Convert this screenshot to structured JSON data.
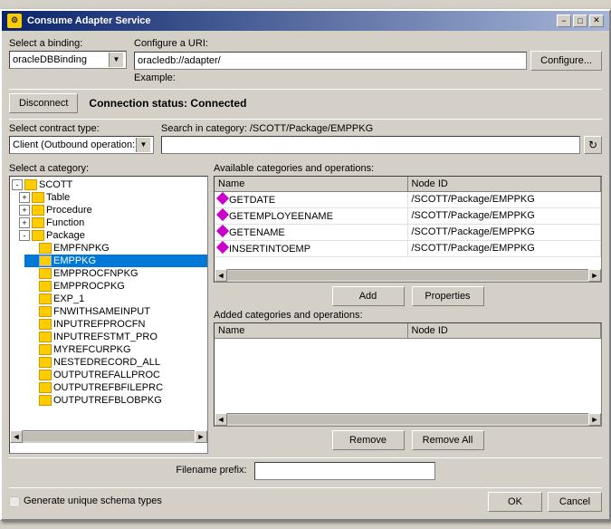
{
  "window": {
    "title": "Consume Adapter Service",
    "title_icon": "⚙"
  },
  "title_buttons": {
    "minimize": "−",
    "maximize": "□",
    "close": "✕"
  },
  "binding": {
    "label": "Select a binding:",
    "value": "oracleDBBinding"
  },
  "uri": {
    "label": "Configure a URI:",
    "value": "oracledb://adapter/",
    "example_label": "Example:",
    "configure_btn": "Configure..."
  },
  "disconnect_btn": "Disconnect",
  "connection_status": "Connection status: Connected",
  "contract": {
    "label": "Select contract type:",
    "value": "Client (Outbound operation:"
  },
  "search": {
    "label": "Search in category: /SCOTT/Package/EMPPKG",
    "placeholder": ""
  },
  "category": {
    "label": "Select a category:"
  },
  "tree_items": [
    {
      "id": "scott",
      "label": "SCOTT",
      "indent": 0,
      "expanded": true,
      "type": "node"
    },
    {
      "id": "table",
      "label": "Table",
      "indent": 1,
      "expanded": true,
      "type": "leaf"
    },
    {
      "id": "procedure",
      "label": "Procedure",
      "indent": 1,
      "expanded": true,
      "type": "leaf"
    },
    {
      "id": "function",
      "label": "Function",
      "indent": 1,
      "expanded": true,
      "type": "leaf"
    },
    {
      "id": "package",
      "label": "Package",
      "indent": 1,
      "expanded": true,
      "type": "node"
    },
    {
      "id": "empfnpkg",
      "label": "EMPFNPKG",
      "indent": 2,
      "expanded": false,
      "type": "leaf"
    },
    {
      "id": "emppkg",
      "label": "EMPPKG",
      "indent": 2,
      "expanded": false,
      "type": "leaf",
      "selected": true
    },
    {
      "id": "empprocfnpkg",
      "label": "EMPPROCFNPKG",
      "indent": 2,
      "expanded": false,
      "type": "leaf"
    },
    {
      "id": "empprocpkg",
      "label": "EMPPROCPKG",
      "indent": 2,
      "expanded": false,
      "type": "leaf"
    },
    {
      "id": "exp1",
      "label": "EXP_1",
      "indent": 2,
      "expanded": false,
      "type": "leaf"
    },
    {
      "id": "fnwithsame",
      "label": "FNWITHSAMEINPUT",
      "indent": 2,
      "expanded": false,
      "type": "leaf"
    },
    {
      "id": "inputrefprocfn",
      "label": "INPUTREFPROCFN",
      "indent": 2,
      "expanded": false,
      "type": "leaf"
    },
    {
      "id": "inputrefstmt",
      "label": "INPUTREFSTMT_PRO",
      "indent": 2,
      "expanded": false,
      "type": "leaf"
    },
    {
      "id": "myrefcurpkg",
      "label": "MYREFCURPKG",
      "indent": 2,
      "expanded": false,
      "type": "leaf"
    },
    {
      "id": "nestedrecord",
      "label": "NESTEDRECORD_ALL",
      "indent": 2,
      "expanded": false,
      "type": "leaf"
    },
    {
      "id": "outputrefallproc",
      "label": "OUTPUTREFALLPROC",
      "indent": 2,
      "expanded": false,
      "type": "leaf"
    },
    {
      "id": "outputrefbfile",
      "label": "OUTPUTREFBFILEPRC",
      "indent": 2,
      "expanded": false,
      "type": "leaf"
    },
    {
      "id": "outputrefblobpkg",
      "label": "OUTPUTREFBLOBPKG",
      "indent": 2,
      "expanded": false,
      "type": "leaf"
    }
  ],
  "available_table": {
    "label": "Available categories and operations:",
    "headers": [
      "Name",
      "Node ID"
    ],
    "rows": [
      {
        "name": "GETDATE",
        "node_id": "/SCOTT/Package/EMPPKG"
      },
      {
        "name": "GETEMPLOYEENAME",
        "node_id": "/SCOTT/Package/EMPPKG"
      },
      {
        "name": "GETENAME",
        "node_id": "/SCOTT/Package/EMPPKG"
      },
      {
        "name": "INSERTINTOEMP",
        "node_id": "/SCOTT/Package/EMPPKG"
      }
    ]
  },
  "add_btn": "Add",
  "properties_btn": "Properties",
  "added_table": {
    "label": "Added categories and operations:",
    "headers": [
      "Name",
      "Node ID"
    ],
    "rows": []
  },
  "remove_btn": "Remove",
  "remove_all_btn": "Remove All",
  "filename": {
    "label": "Filename prefix:"
  },
  "generate_checkbox": "Generate unique schema types",
  "ok_btn": "OK",
  "cancel_btn": "Cancel"
}
